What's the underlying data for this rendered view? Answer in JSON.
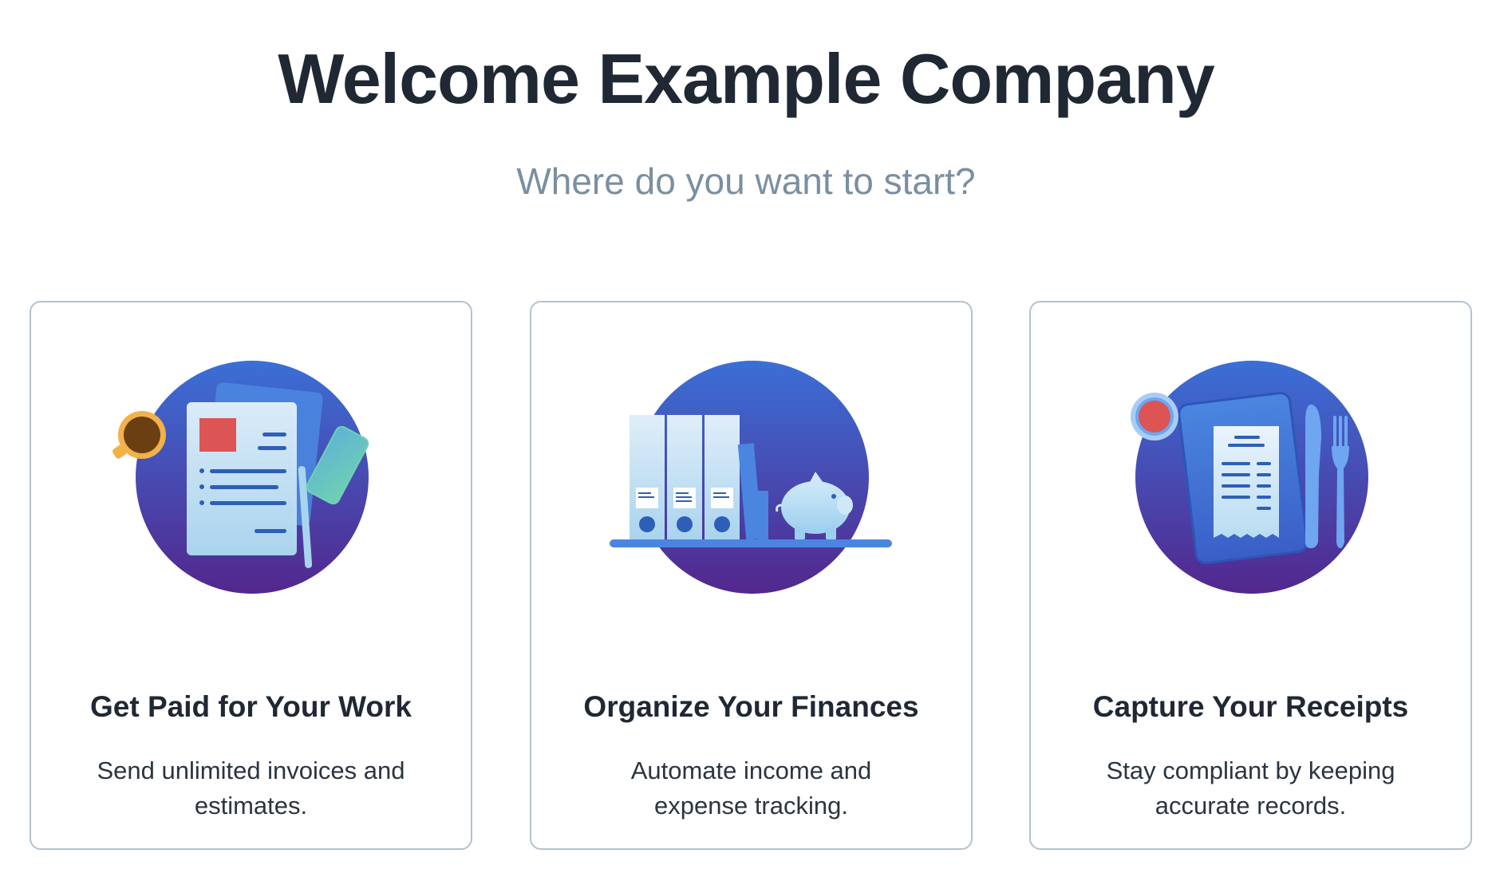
{
  "header": {
    "title": "Welcome Example Company",
    "subtitle": "Where do you want to start?"
  },
  "cards": [
    {
      "title": "Get Paid for Your Work",
      "description": "Send unlimited invoices and estimates.",
      "icon": "invoice-illustration-icon"
    },
    {
      "title": "Organize Your Finances",
      "description": "Automate income and expense tracking.",
      "icon": "finance-binders-illustration-icon"
    },
    {
      "title": "Capture Your Receipts",
      "description": "Stay compliant by keeping accurate records.",
      "icon": "receipt-illustration-icon"
    }
  ],
  "colors": {
    "title": "#1f2833",
    "subtitle": "#7a8fa0",
    "card_border": "#b4c2cf",
    "circle_top": "#3b6fd6",
    "circle_bottom": "#53278d",
    "accent_red": "#dc5454"
  }
}
